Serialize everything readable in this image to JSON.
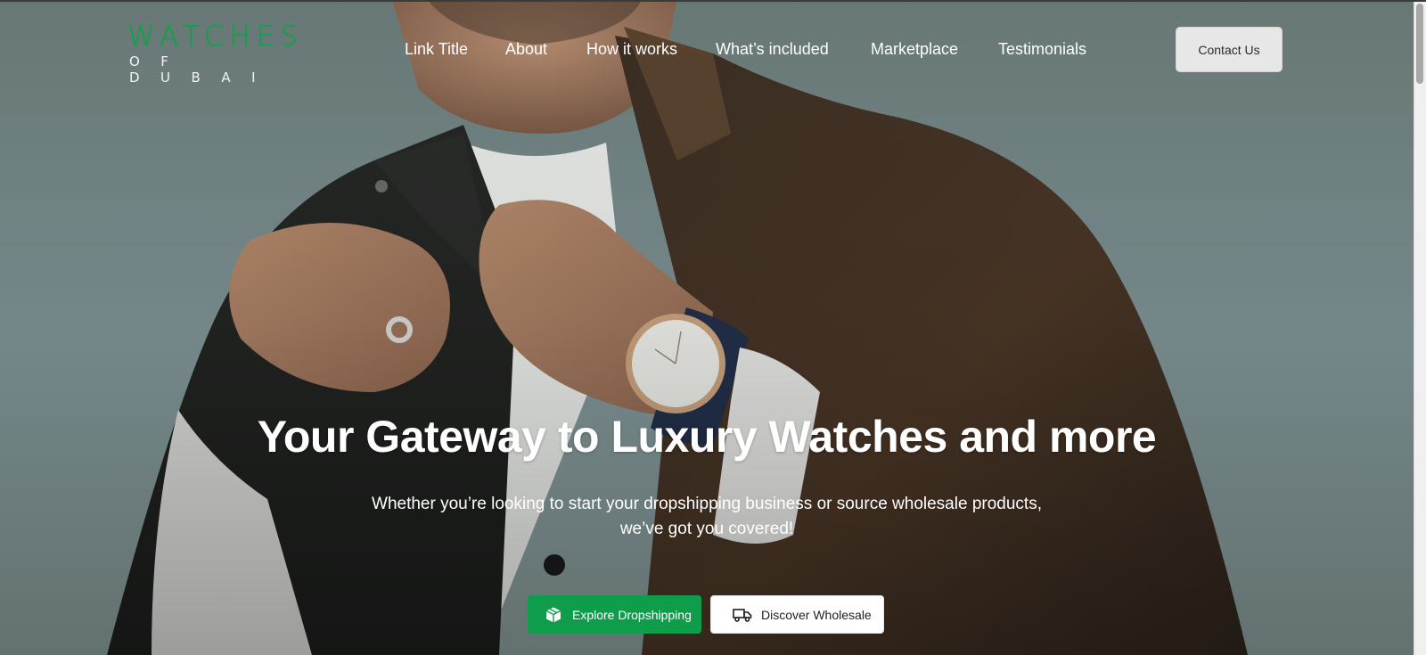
{
  "brand": {
    "logo_word": "WATCHES",
    "logo_sub": "OF DUBAI",
    "logo_color": "#14a04a"
  },
  "nav": {
    "items": [
      {
        "label": "Link Title"
      },
      {
        "label": "About"
      },
      {
        "label": "How it works"
      },
      {
        "label": "What’s included"
      },
      {
        "label": "Marketplace"
      },
      {
        "label": "Testimonials"
      }
    ],
    "contact_label": "Contact Us"
  },
  "hero": {
    "headline": "Your Gateway to Luxury Watches and more",
    "subhead_line1": "Whether you’re looking to start your dropshipping business or source wholesale products,",
    "subhead_line2": "we’ve got you covered!",
    "background_image": "man-in-jacket-wearing-wristwatch"
  },
  "cta": {
    "primary_label": "Explore Dropshipping",
    "primary_icon": "box-icon",
    "primary_color": "#0f9d4b",
    "secondary_label": "Discover Wholesale",
    "secondary_icon": "truck-icon"
  }
}
